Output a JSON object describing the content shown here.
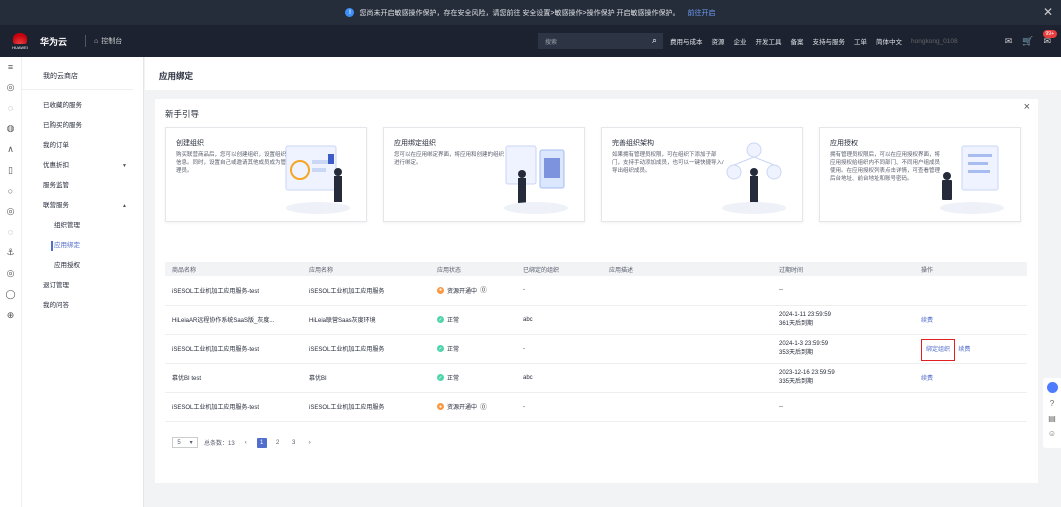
{
  "banner": {
    "icon": "info-icon",
    "text": "您尚未开启敏感操作保护，存在安全风险，请您前往 安全设置>敏感操作>操作保护 开启敏感操作保护。",
    "link": "前往开启",
    "close": "✕"
  },
  "topnav": {
    "logo_text": "HUAWEI",
    "brand": "华为云",
    "console": "控制台",
    "search_placeholder": "搜索",
    "links": [
      "费用与成本",
      "资源",
      "企业",
      "开发工具",
      "备案",
      "支持与服务",
      "工单",
      "简体中文",
      "hongkong_0108"
    ],
    "badge": "99+"
  },
  "sidebar": {
    "title": "我的云商店",
    "items": [
      {
        "label": "已收藏的服务"
      },
      {
        "label": "已购买的服务"
      },
      {
        "label": "我的订单"
      },
      {
        "label": "优惠折扣",
        "caret": "▼"
      },
      {
        "label": "服务监管"
      },
      {
        "label": "联营服务",
        "caret": "▲"
      },
      {
        "label": "组织管理"
      },
      {
        "label": "应用绑定"
      },
      {
        "label": "应用授权"
      },
      {
        "label": "退订管理"
      },
      {
        "label": "我的问答"
      }
    ]
  },
  "page": {
    "title": "应用绑定"
  },
  "guide": {
    "title": "新手引导",
    "close": "×",
    "cards": [
      {
        "title": "创建组织",
        "desc": "购买联营商品后，您可以创建组织，设置组织信息。同时，设置自己或邀请其他成员成为管理员。"
      },
      {
        "title": "应用绑定组织",
        "desc": "您可以在应用绑定界面，将应用和创建的组织进行绑定。"
      },
      {
        "title": "完善组织架构",
        "desc": "如果拥有管理员权限，可在组织下添加子部门，支持手动添加成员，也可以一键快捷导入/导出组织成员。"
      },
      {
        "title": "应用授权",
        "desc": "拥有管理员权限后，可以在应用授权界面，将应用授权给组织内不同部门、不同用户组成员使用。在应用授权列表点击详情，可查看管理后台地址、前台地址和账号密码。"
      }
    ]
  },
  "table": {
    "headers": [
      "商品名称",
      "应用名称",
      "应用状态",
      "已绑定的组织",
      "应用描述",
      "过期时间",
      "操作"
    ],
    "rows": [
      {
        "product": "iSESOL工业机加工应用服务-test",
        "app": "iSESOL工业机加工应用服务",
        "status": "资源开通中",
        "status_type": "wait",
        "org": "-",
        "desc": "",
        "expire": "--",
        "expire2": "",
        "actions": []
      },
      {
        "product": "HiLeiaAR远程协作系统SaaS版_灰度...",
        "app": "HiLeia联营Saas灰度环境",
        "status": "正常",
        "status_type": "ok",
        "org": "abc",
        "desc": "",
        "expire": "2024-1-11 23:59:59",
        "expire2": "361天后到期",
        "actions": [
          "续费"
        ]
      },
      {
        "product": "iSESOL工业机加工应用服务-test",
        "app": "iSESOL工业机加工应用服务",
        "status": "正常",
        "status_type": "ok",
        "org": "-",
        "desc": "",
        "expire": "2024-1-3 23:59:59",
        "expire2": "353天后到期",
        "actions": [
          "绑定组织",
          "续费"
        ]
      },
      {
        "product": "慕优BI test",
        "app": "慕优BI",
        "status": "正常",
        "status_type": "ok",
        "org": "abc",
        "desc": "",
        "expire": "2023-12-16 23:59:59",
        "expire2": "335天后到期",
        "actions": [
          "续费"
        ]
      },
      {
        "product": "iSESOL工业机加工应用服务-test",
        "app": "iSESOL工业机加工应用服务",
        "status": "资源开通中",
        "status_type": "wait",
        "org": "-",
        "desc": "",
        "expire": "--",
        "expire2": "",
        "actions": []
      }
    ]
  },
  "pager": {
    "page_size": "5",
    "total": "总条数：13",
    "prev": "‹",
    "pages": [
      "1",
      "2",
      "3"
    ],
    "next": "›"
  }
}
